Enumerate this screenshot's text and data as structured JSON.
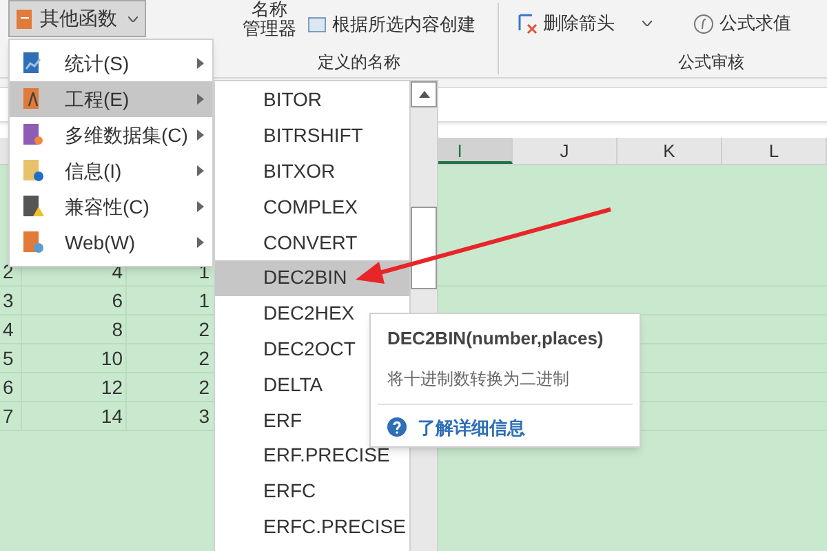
{
  "ribbon": {
    "more_functions": "其他函数",
    "name_manager": [
      "名称",
      "管理器"
    ],
    "create_from_selection": "根据所选内容创建",
    "defined_names_group": "定义的名称",
    "remove_arrows": "删除箭头",
    "evaluate_formula": "公式求值",
    "formula_auditing_group": "公式审核"
  },
  "column_headers": [
    {
      "label": "I",
      "selected": true
    },
    {
      "label": "J",
      "selected": false
    },
    {
      "label": "K",
      "selected": false
    },
    {
      "label": "L",
      "selected": false
    }
  ],
  "rows": [
    {
      "row": "2",
      "column_2": "4",
      "column_3": "1"
    },
    {
      "row": "3",
      "column_2": "6",
      "column_3": "1"
    },
    {
      "row": "4",
      "column_2": "8",
      "column_3": "2"
    },
    {
      "row": "5",
      "column_2": "10",
      "column_3": "2"
    },
    {
      "row": "6",
      "column_2": "12",
      "column_3": "2"
    },
    {
      "row": "7",
      "column_2": "14",
      "column_3": "3"
    }
  ],
  "category_menu": [
    {
      "label": "统计(S)",
      "kind": "chart",
      "selected": false
    },
    {
      "label": "工程(E)",
      "kind": "compass",
      "selected": true
    },
    {
      "label": "多维数据集(C)",
      "kind": "cube",
      "selected": false
    },
    {
      "label": "信息(I)",
      "kind": "info",
      "selected": false
    },
    {
      "label": "兼容性(C)",
      "kind": "warning",
      "selected": false
    },
    {
      "label": "Web(W)",
      "kind": "globe",
      "selected": false
    }
  ],
  "function_menu": [
    {
      "label": "BITOR",
      "selected": false
    },
    {
      "label": "BITRSHIFT",
      "selected": false
    },
    {
      "label": "BITXOR",
      "selected": false
    },
    {
      "label": "COMPLEX",
      "selected": false
    },
    {
      "label": "CONVERT",
      "selected": false
    },
    {
      "label": "DEC2BIN",
      "selected": true
    },
    {
      "label": "DEC2HEX",
      "selected": false
    },
    {
      "label": "DEC2OCT",
      "selected": false
    },
    {
      "label": "DELTA",
      "selected": false
    },
    {
      "label": "ERF",
      "selected": false
    },
    {
      "label": "ERF.PRECISE",
      "selected": false
    },
    {
      "label": "ERFC",
      "selected": false
    },
    {
      "label": "ERFC.PRECISE",
      "selected": false
    }
  ],
  "tooltip": {
    "signature": "DEC2BIN(number,places)",
    "description": "将十进制数转换为二进制",
    "link": "了解详细信息"
  }
}
